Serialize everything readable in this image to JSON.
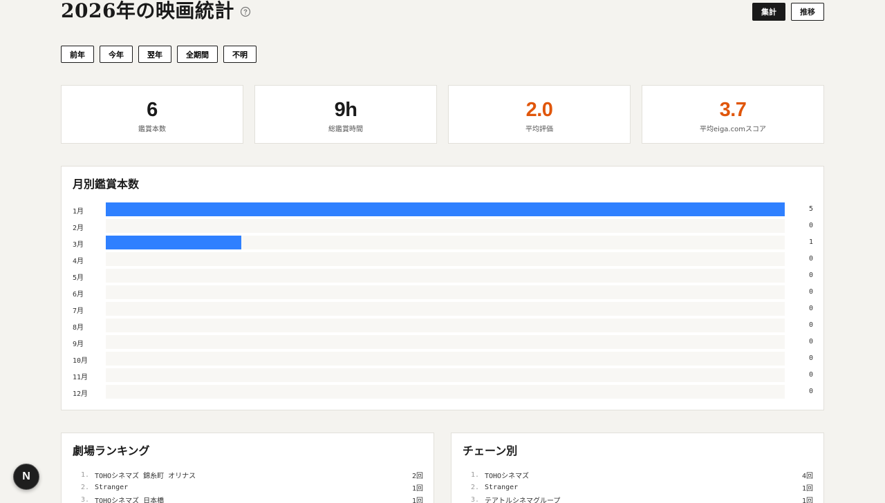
{
  "header": {
    "title": "2026年の映画統計",
    "view_tabs": [
      {
        "label": "集計",
        "active": true
      },
      {
        "label": "推移",
        "active": false
      }
    ]
  },
  "filters": [
    "前年",
    "今年",
    "翌年",
    "全期間",
    "不明"
  ],
  "stats": [
    {
      "value": "6",
      "label": "鑑賞本数",
      "accent": false
    },
    {
      "value": "9h",
      "label": "総鑑賞時間",
      "accent": false
    },
    {
      "value": "2.0",
      "label": "平均評価",
      "accent": true
    },
    {
      "value": "3.7",
      "label": "平均eiga.comスコア",
      "accent": true
    }
  ],
  "monthly": {
    "title": "月別鑑賞本数",
    "max": 5,
    "bar_color": "#2f80ff",
    "months": [
      {
        "label": "1月",
        "count": 5
      },
      {
        "label": "2月",
        "count": 0
      },
      {
        "label": "3月",
        "count": 1
      },
      {
        "label": "4月",
        "count": 0
      },
      {
        "label": "5月",
        "count": 0
      },
      {
        "label": "6月",
        "count": 0
      },
      {
        "label": "7月",
        "count": 0
      },
      {
        "label": "8月",
        "count": 0
      },
      {
        "label": "9月",
        "count": 0
      },
      {
        "label": "10月",
        "count": 0
      },
      {
        "label": "11月",
        "count": 0
      },
      {
        "label": "12月",
        "count": 0
      }
    ]
  },
  "theaters": {
    "title": "劇場ランキング",
    "items": [
      {
        "rank": "1.",
        "name": "TOHOシネマズ 錦糸町 オリナス",
        "count": "2回"
      },
      {
        "rank": "2.",
        "name": "Stranger",
        "count": "1回"
      },
      {
        "rank": "3.",
        "name": "TOHOシネマズ 日本橋",
        "count": "1回"
      }
    ]
  },
  "chains": {
    "title": "チェーン別",
    "items": [
      {
        "rank": "1.",
        "name": "TOHOシネマズ",
        "count": "4回"
      },
      {
        "rank": "2.",
        "name": "Stranger",
        "count": "1回"
      },
      {
        "rank": "3.",
        "name": "テアトルシネマグループ",
        "count": "1回"
      }
    ]
  },
  "badge": {
    "label": "N",
    "icon": "nextjs-dev-indicator-icon"
  },
  "accent_color": "#e0560b"
}
